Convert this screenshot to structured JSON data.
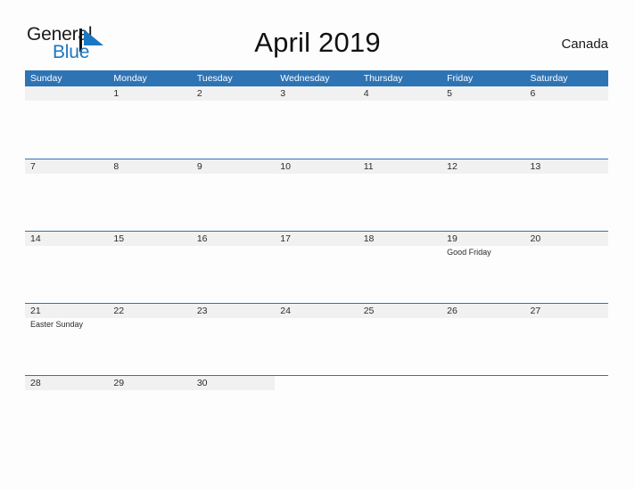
{
  "header": {
    "logo": {
      "primary_text": "General",
      "secondary_text": "Blue",
      "mark_icon": "blue-triangle-logo-icon",
      "primary_color": "#1a1a1a",
      "secondary_color": "#1c77c3"
    },
    "title": "April 2019",
    "region": "Canada"
  },
  "colors": {
    "header_blue": "#2e74b5",
    "band_gray": "#f1f1f1",
    "page_background": "#fdfdfd",
    "text": "#2b2b2b"
  },
  "calendar": {
    "month": "April",
    "year": "2019",
    "weekday_headers": [
      "Sunday",
      "Monday",
      "Tuesday",
      "Wednesday",
      "Thursday",
      "Friday",
      "Saturday"
    ],
    "weeks": [
      [
        {
          "date": "",
          "event": ""
        },
        {
          "date": "1",
          "event": ""
        },
        {
          "date": "2",
          "event": ""
        },
        {
          "date": "3",
          "event": ""
        },
        {
          "date": "4",
          "event": ""
        },
        {
          "date": "5",
          "event": ""
        },
        {
          "date": "6",
          "event": ""
        }
      ],
      [
        {
          "date": "7",
          "event": ""
        },
        {
          "date": "8",
          "event": ""
        },
        {
          "date": "9",
          "event": ""
        },
        {
          "date": "10",
          "event": ""
        },
        {
          "date": "11",
          "event": ""
        },
        {
          "date": "12",
          "event": ""
        },
        {
          "date": "13",
          "event": ""
        }
      ],
      [
        {
          "date": "14",
          "event": ""
        },
        {
          "date": "15",
          "event": ""
        },
        {
          "date": "16",
          "event": ""
        },
        {
          "date": "17",
          "event": ""
        },
        {
          "date": "18",
          "event": ""
        },
        {
          "date": "19",
          "event": "Good Friday"
        },
        {
          "date": "20",
          "event": ""
        }
      ],
      [
        {
          "date": "21",
          "event": "Easter Sunday"
        },
        {
          "date": "22",
          "event": ""
        },
        {
          "date": "23",
          "event": ""
        },
        {
          "date": "24",
          "event": ""
        },
        {
          "date": "25",
          "event": ""
        },
        {
          "date": "26",
          "event": ""
        },
        {
          "date": "27",
          "event": ""
        }
      ],
      [
        {
          "date": "28",
          "event": ""
        },
        {
          "date": "29",
          "event": ""
        },
        {
          "date": "30",
          "event": ""
        },
        {
          "date": "",
          "event": ""
        },
        {
          "date": "",
          "event": ""
        },
        {
          "date": "",
          "event": ""
        },
        {
          "date": "",
          "event": ""
        }
      ]
    ]
  }
}
